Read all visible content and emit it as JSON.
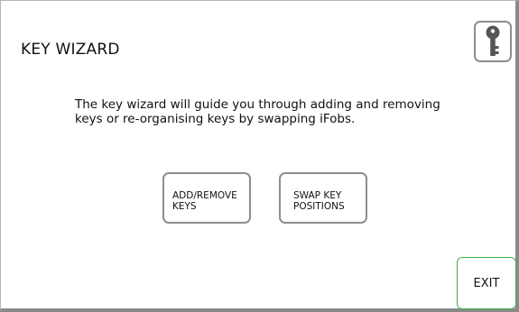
{
  "header": {
    "title": "KEY WIZARD",
    "key_icon": "key-icon"
  },
  "main": {
    "intro_text": "The key wizard will guide you through adding and removing keys or re-organising keys by swapping iFobs.",
    "add_remove_label": "ADD/REMOVE\nKEYS",
    "swap_label": "SWAP KEY\nPOSITIONS"
  },
  "footer": {
    "exit_label": "EXIT"
  },
  "colors": {
    "exit_border": "#3fb04a",
    "button_border": "#8e8e8e",
    "icon_fill": "#555555"
  }
}
